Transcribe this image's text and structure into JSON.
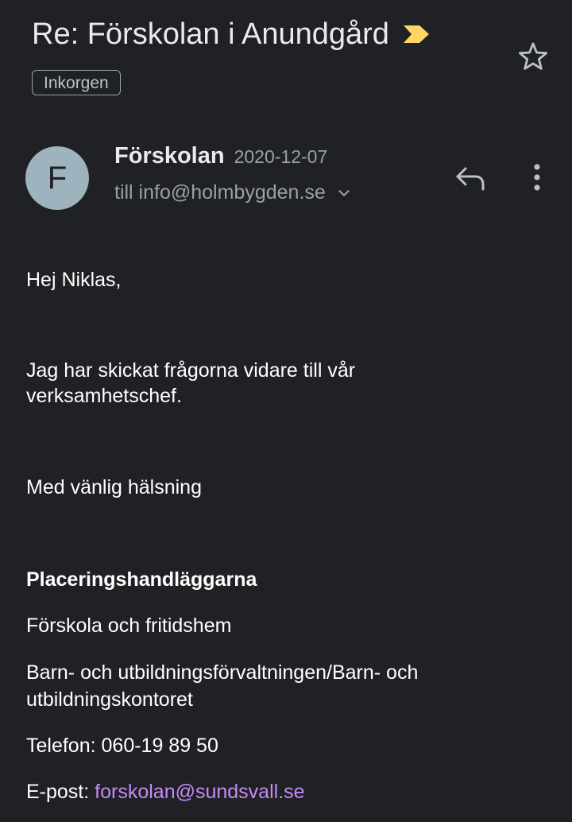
{
  "header": {
    "subject": "Re: Förskolan i Anundgård",
    "label": "Inkorgen",
    "importance_color": "#fdd663",
    "star_icon": "star-outline-icon"
  },
  "message": {
    "avatar_letter": "F",
    "avatar_color": "#9eb3bd",
    "sender_name": "Förskolan",
    "date": "2020-12-07",
    "recipient_line": "till info@holmbygden.se",
    "icons": [
      "reply-icon",
      "more-vert-icon",
      "chevron-down-icon"
    ]
  },
  "body": {
    "greeting": "Hej Niklas,",
    "line1": "Jag har skickat frågorna vidare till vår",
    "line2": "verksamhetschef.",
    "closing": "Med vänlig hälsning",
    "signature": {
      "team": "Placeringshandläggarna",
      "unit": "Förskola och fritidshem",
      "department_line1": "Barn- och utbildningsförvaltningen/Barn- och",
      "department_line2": "utbildningskontoret",
      "phone": "Telefon: 060-19 89 50",
      "email_label": "E-post:",
      "email": "forskolan@sundsvall.se"
    }
  }
}
